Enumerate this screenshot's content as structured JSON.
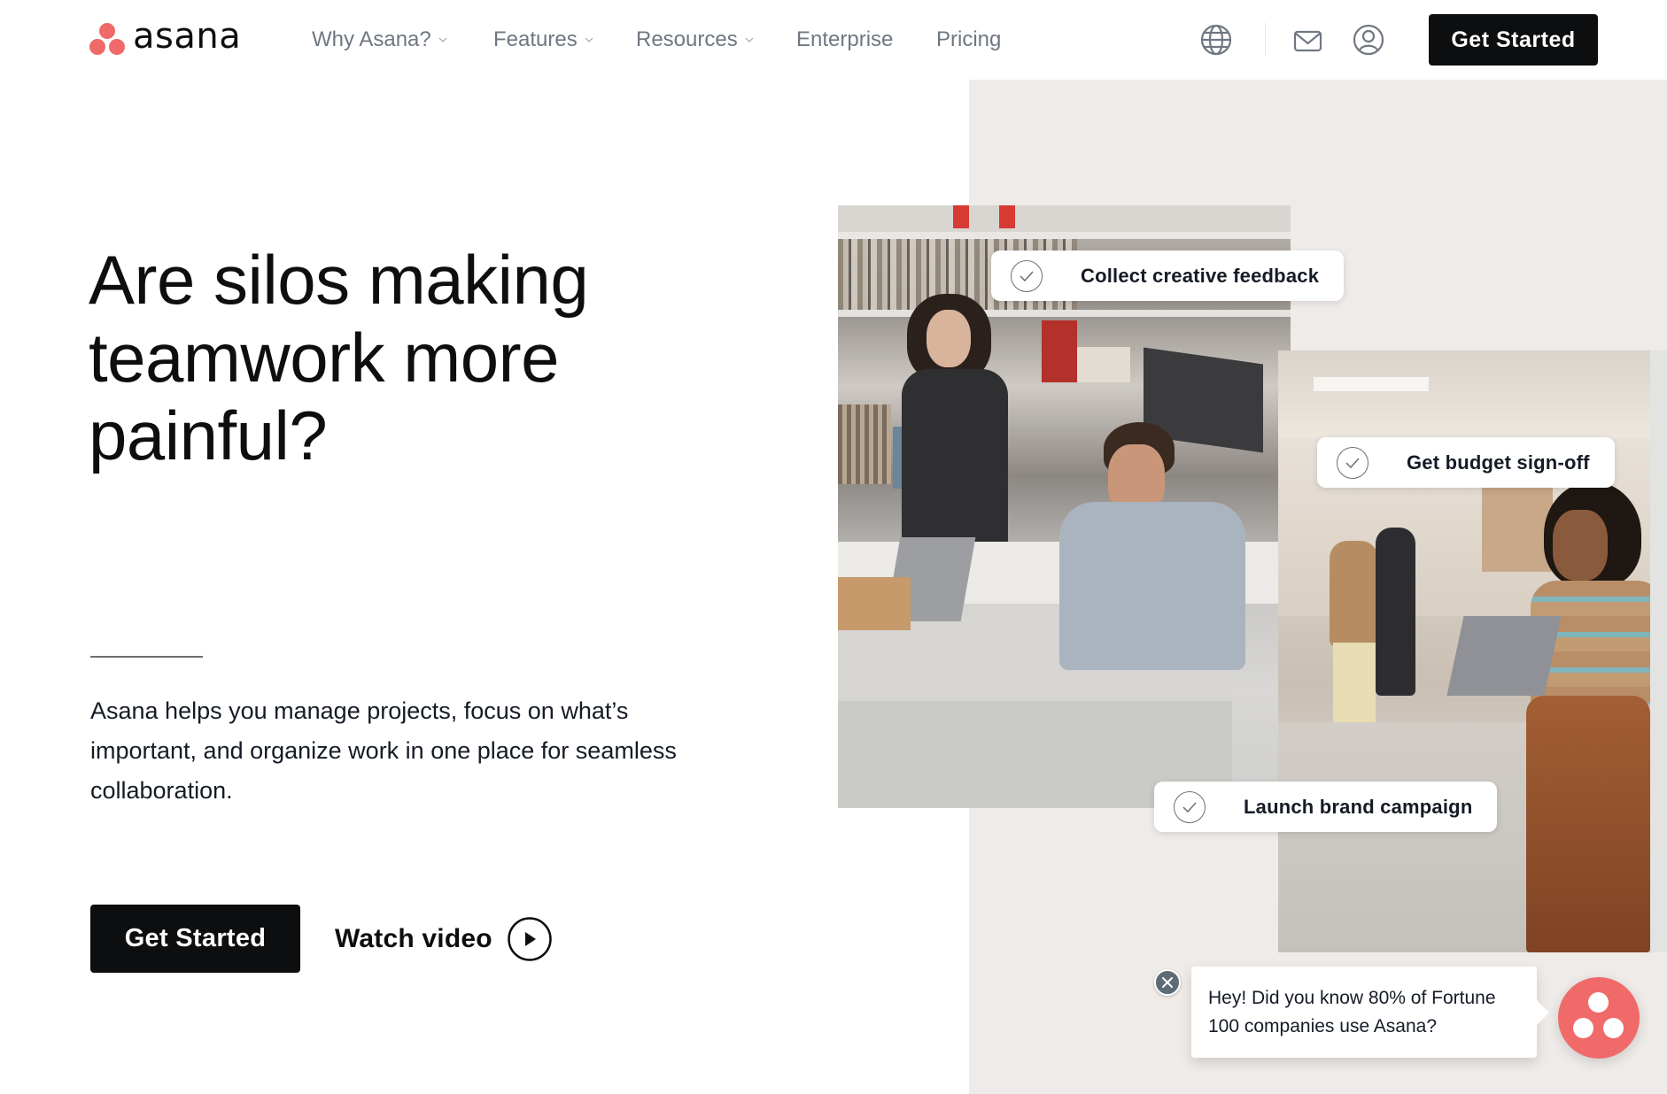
{
  "header": {
    "logo_text": "asana",
    "nav": [
      {
        "label": "Why Asana?",
        "has_dropdown": true
      },
      {
        "label": "Features",
        "has_dropdown": true
      },
      {
        "label": "Resources",
        "has_dropdown": true
      },
      {
        "label": "Enterprise",
        "has_dropdown": false
      },
      {
        "label": "Pricing",
        "has_dropdown": false
      }
    ],
    "icons": [
      "globe-icon",
      "mail-icon",
      "account-icon"
    ],
    "cta_label": "Get Started"
  },
  "hero": {
    "headline_lines": [
      "Are silos making",
      "teamwork more",
      "painful?"
    ],
    "lead_lines": [
      "Asana helps you manage projects, focus on what’s",
      "important, and organize work in one place for seamless",
      "collaboration."
    ],
    "cta_label": "Get Started",
    "watch_label": "Watch video"
  },
  "visual": {
    "tasks": [
      {
        "label": "Collect creative feedback",
        "status": "check-icon"
      },
      {
        "label": "Get budget sign-off",
        "status": "check-icon"
      },
      {
        "label": "Launch brand campaign",
        "status": "check-icon"
      }
    ],
    "photos": [
      "office-team-photo",
      "office-hallway-photo"
    ]
  },
  "chat": {
    "message_lines": [
      "Hey! Did you know 80% of Fortune",
      "100 companies use Asana?"
    ],
    "close_icon": "close-icon",
    "avatar_icon": "asana-logo-icon"
  },
  "colors": {
    "brand_coral": "#f06a6a",
    "button_black": "#0d0e10",
    "panel_beige": "#efebe9",
    "nav_gray": "#6f7782"
  }
}
